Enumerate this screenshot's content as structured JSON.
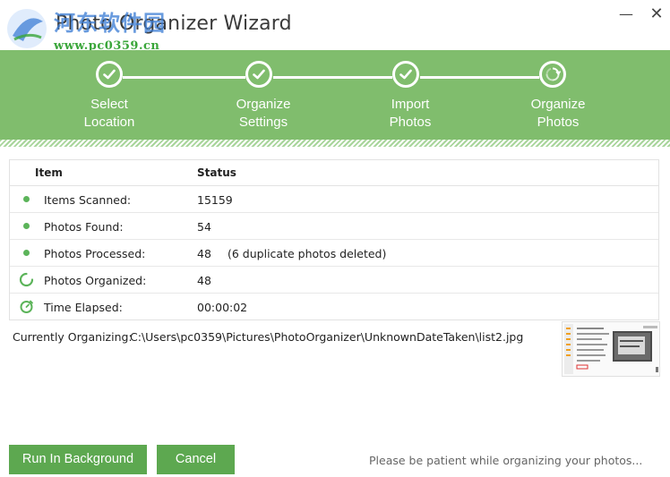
{
  "window": {
    "title": "Photo Organizer Wizard",
    "minimize_symbol": "—",
    "close_symbol": "✕"
  },
  "watermark": {
    "site_name": "河东软件园",
    "url": "www.pc0359.cn"
  },
  "steps": [
    {
      "line1": "Select",
      "line2": "Location",
      "status": "done",
      "icon": "check-icon"
    },
    {
      "line1": "Organize",
      "line2": "Settings",
      "status": "done",
      "icon": "check-icon"
    },
    {
      "line1": "Import",
      "line2": "Photos",
      "status": "done",
      "icon": "check-icon"
    },
    {
      "line1": "Organize",
      "line2": "Photos",
      "status": "in-progress",
      "icon": "spinner-icon"
    }
  ],
  "table": {
    "headers": {
      "item": "Item",
      "status": "Status"
    },
    "rows": [
      {
        "label": "Items Scanned:",
        "value": "15159",
        "note": "",
        "icon": "green-dot-icon"
      },
      {
        "label": "Photos Found:",
        "value": "54",
        "note": "",
        "icon": "green-dot-icon"
      },
      {
        "label": "Photos Processed:",
        "value": "48",
        "note": "(6 duplicate photos deleted)",
        "icon": "green-dot-icon"
      },
      {
        "label": "Photos Organized:",
        "value": "48",
        "note": "",
        "icon": "spinner-icon"
      },
      {
        "label": "Time Elapsed:",
        "value": "00:00:02",
        "note": "",
        "icon": "timer-icon"
      }
    ]
  },
  "current": {
    "label": "Currently Organizing:",
    "path": "C:\\Users\\pc0359\\Pictures\\PhotoOrganizer\\UnknownDateTaken\\list2.jpg"
  },
  "buttons": {
    "background": "Run In Background",
    "cancel": "Cancel"
  },
  "hint": "Please be patient while organizing your photos...",
  "colors": {
    "banner": "#80bd6d",
    "button": "#5da850",
    "dot": "#5cb45a"
  }
}
